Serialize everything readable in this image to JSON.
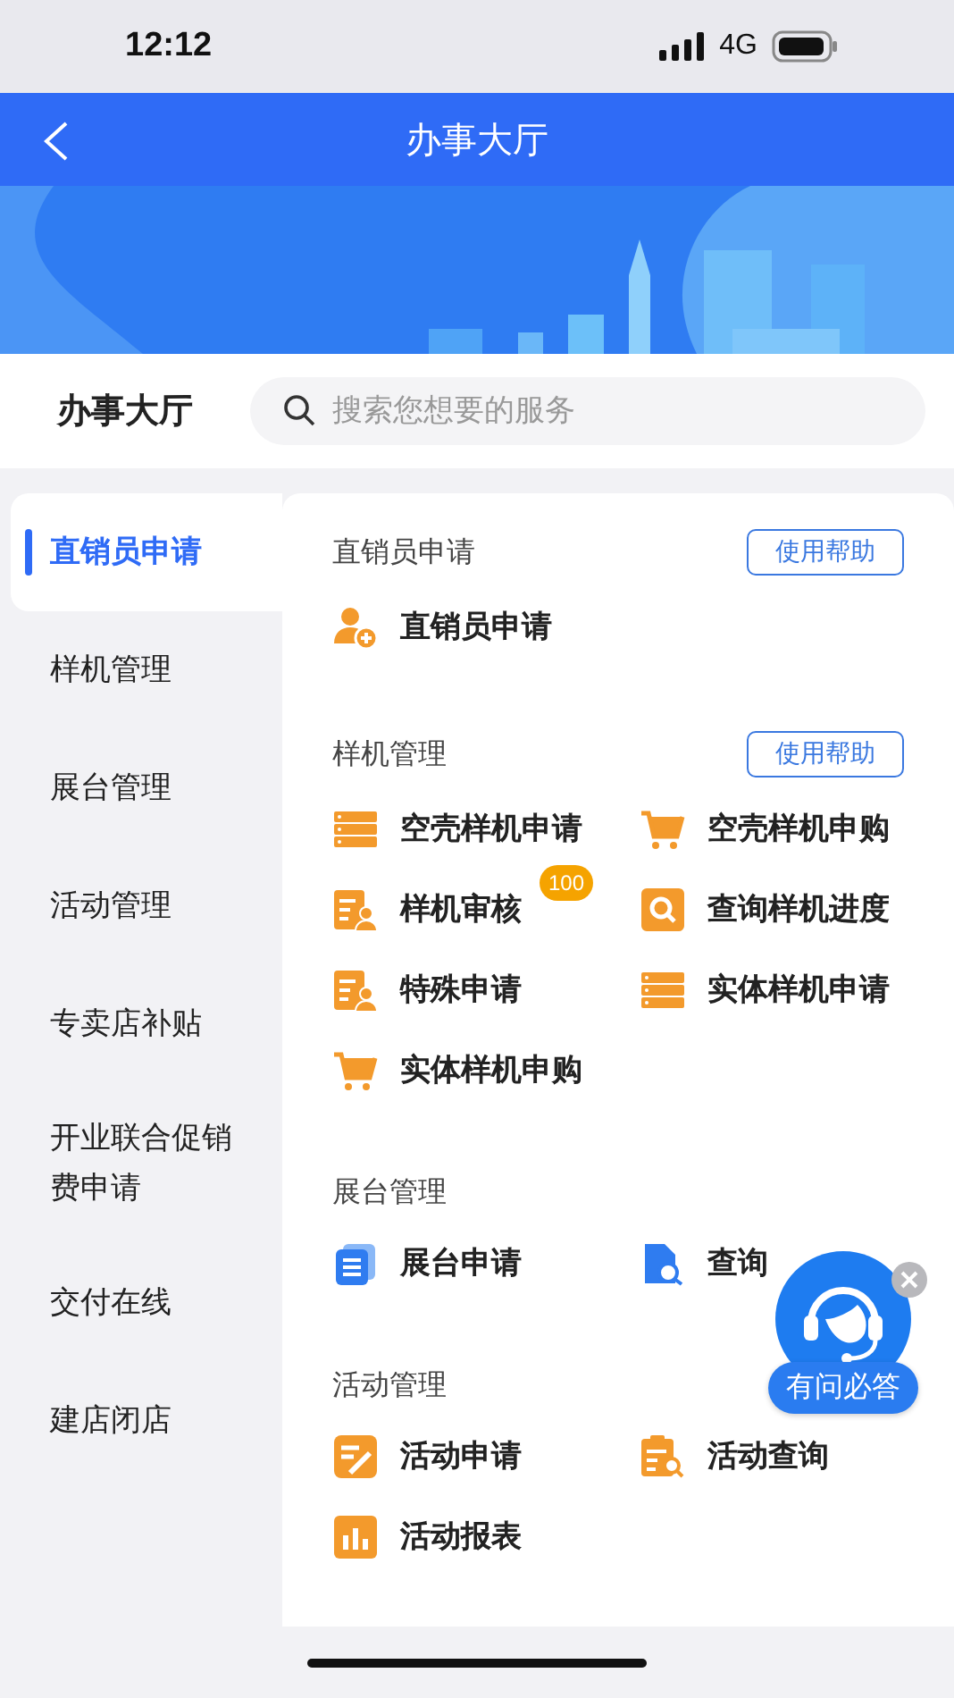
{
  "status_bar": {
    "time": "12:12",
    "network": "4G"
  },
  "nav": {
    "title": "办事大厅"
  },
  "header": {
    "title": "办事大厅",
    "search": {
      "placeholder": "搜索您想要的服务"
    }
  },
  "sidebar": {
    "items": [
      {
        "label": "直销员申请",
        "selected": true
      },
      {
        "label": "样机管理",
        "selected": false
      },
      {
        "label": "展台管理",
        "selected": false
      },
      {
        "label": "活动管理",
        "selected": false
      },
      {
        "label": "专卖店补贴",
        "selected": false
      },
      {
        "label": "开业联合促销费申请",
        "selected": false
      },
      {
        "label": "交付在线",
        "selected": false
      },
      {
        "label": "建店闭店",
        "selected": false
      }
    ]
  },
  "sections": [
    {
      "title": "直销员申请",
      "help": "使用帮助",
      "items": [
        {
          "kind": "person-add",
          "label": "直销员申请"
        }
      ]
    },
    {
      "title": "样机管理",
      "help": "使用帮助",
      "items": [
        {
          "kind": "list",
          "label": "空壳样机申请"
        },
        {
          "kind": "cart",
          "label": "空壳样机申购"
        },
        {
          "kind": "doc-person",
          "label": "样机审核",
          "badge": "100"
        },
        {
          "kind": "search",
          "label": "查询样机进度"
        },
        {
          "kind": "doc-person",
          "label": "特殊申请"
        },
        {
          "kind": "list",
          "label": "实体样机申请"
        },
        {
          "kind": "cart",
          "label": "实体样机申购"
        }
      ]
    },
    {
      "title": "展台管理",
      "items": [
        {
          "kind": "doc-blue",
          "label": "展台申请"
        },
        {
          "kind": "file-search",
          "label": "查询"
        }
      ]
    },
    {
      "title": "活动管理",
      "items": [
        {
          "kind": "edit",
          "label": "活动申请"
        },
        {
          "kind": "clipboard-search",
          "label": "活动查询"
        },
        {
          "kind": "chart",
          "label": "活动报表"
        }
      ]
    }
  ],
  "assistant": {
    "label": "有问必答"
  }
}
